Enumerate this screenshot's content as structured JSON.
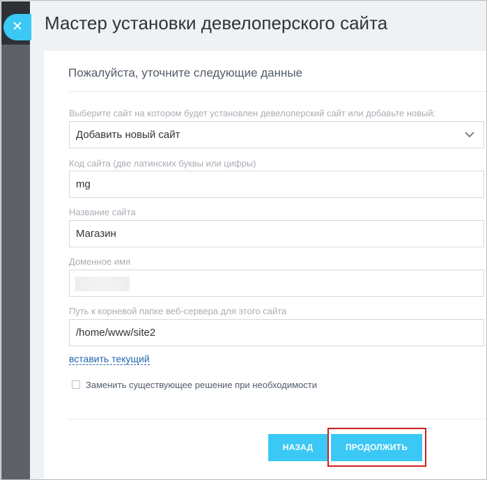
{
  "slider": {
    "close_glyph": "✕",
    "title": "Мастер установки девелоперского сайта"
  },
  "card": {
    "heading": "Пожалуйста, уточните следующие данные"
  },
  "fields": {
    "site_select": {
      "label": "Выберите сайт на котором будет установлен девелоперский сайт или добавьте новый:",
      "value": "Добавить новый сайт"
    },
    "site_code": {
      "label": "Код сайта (две латинских буквы или цифры)",
      "value": "mg"
    },
    "site_name": {
      "label": "Название сайта",
      "value": "Магазин"
    },
    "domain_name": {
      "label": "Доменное имя",
      "value": ""
    },
    "root_path": {
      "label": "Путь к корневой папке веб-сервера для этого сайта",
      "value": "/home/www/site2"
    }
  },
  "insert_current_link": "вставить текущий",
  "replace_checkbox": {
    "label": "Заменить существующее решение при необходимости",
    "checked": false
  },
  "buttons": {
    "back": "НАЗАД",
    "continue": "ПРОДОЛЖИТЬ"
  },
  "colors": {
    "accent": "#3bc8f5",
    "highlight": "#cc1f1f",
    "link": "#2067b0"
  }
}
